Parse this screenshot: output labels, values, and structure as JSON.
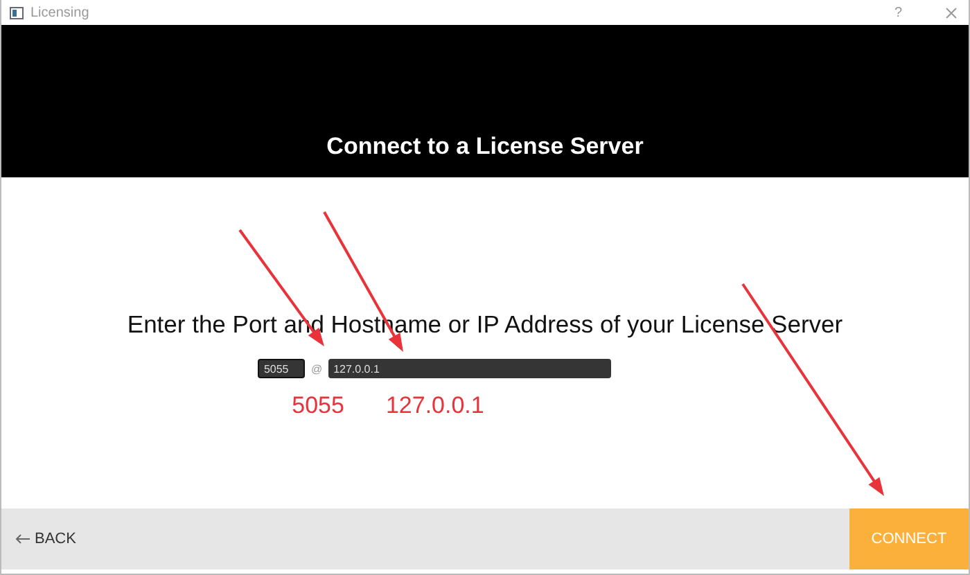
{
  "window": {
    "title": "Licensing",
    "help": "?"
  },
  "header": {
    "title": "Connect to a License Server"
  },
  "prompt": "Enter the Port and Hostname or IP Address of your License Server",
  "server": {
    "port": "5055",
    "separator": "@",
    "host": "127.0.0.1"
  },
  "annotations": [
    {
      "text": "5055"
    },
    {
      "text": "127.0.0.1"
    }
  ],
  "footer": {
    "back": "BACK",
    "connect": "CONNECT"
  }
}
